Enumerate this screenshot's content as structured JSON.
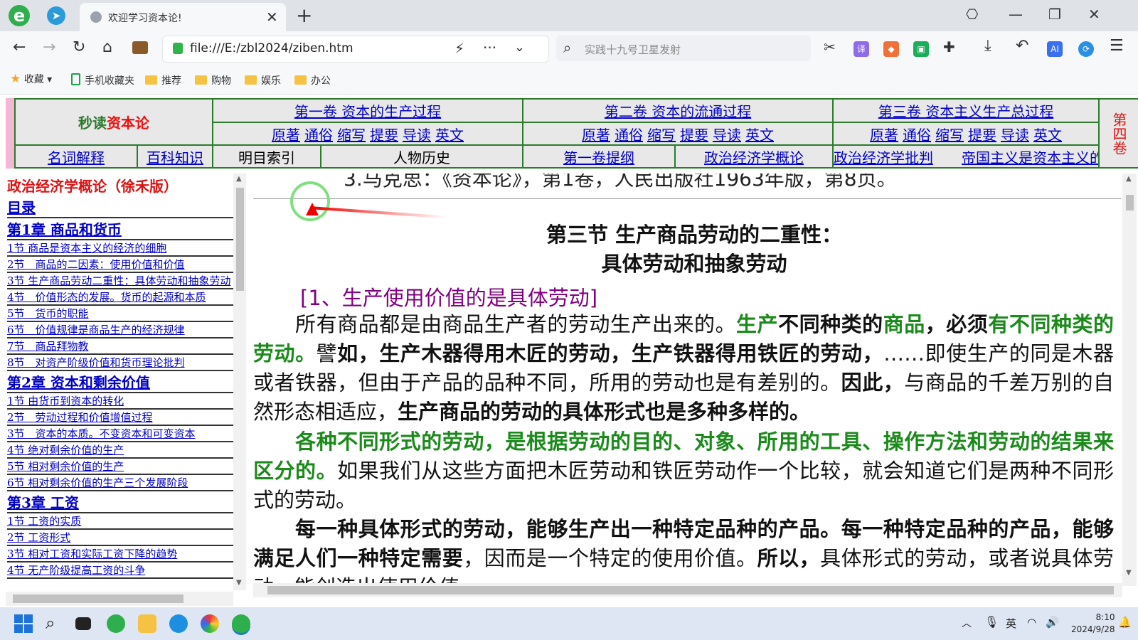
{
  "browser": {
    "tab_title": "欢迎学习资本论!",
    "url": "file:///E:/zbl2024/ziben.htm",
    "search_placeholder": "实践十九号卫星发射",
    "ext_translate": "译",
    "ext_ai": "AI"
  },
  "bookmarks": [
    {
      "label": "收藏"
    },
    {
      "label": "手机收藏夹"
    },
    {
      "label": "推荐"
    },
    {
      "label": "购物"
    },
    {
      "label": "娱乐"
    },
    {
      "label": "办公"
    }
  ],
  "topnav": {
    "brand_part1": "秒读",
    "brand_part2": "资本论",
    "vol1": "第一卷 资本的生产过程",
    "vol2": "第二卷 资本的流通过程",
    "vol3": "第三卷 资本主义生产总过程",
    "vol4": "第四卷",
    "sub_links": [
      "原著",
      "通俗",
      "缩写",
      "提要",
      "导读",
      "英文"
    ],
    "row3": [
      "名词解释",
      "百科知识",
      "明目索引",
      "人物历史",
      "第一卷提纲",
      "政治经济学概论",
      "政治经济学批判",
      "帝国主义是资本主义的最高阶段"
    ]
  },
  "toc": {
    "title": "政治经济学概论（徐禾版）",
    "items": [
      {
        "type": "ch",
        "label": "目录"
      },
      {
        "type": "ch",
        "label": "第1章 商品和货币"
      },
      {
        "type": "it",
        "label": "1节 商品是资本主义的经济的细胞"
      },
      {
        "type": "it",
        "label": "2节　商品的二因素：使用价值和价值"
      },
      {
        "type": "it",
        "label": "3节 生产商品劳动二重性：具体劳动和抽象劳动"
      },
      {
        "type": "it",
        "label": "4节　价值形态的发展。货币的起源和本质"
      },
      {
        "type": "it",
        "label": "5节　货币的职能"
      },
      {
        "type": "it",
        "label": "6节　价值规律是商品生产的经济规律"
      },
      {
        "type": "it",
        "label": "7节　商品拜物教"
      },
      {
        "type": "it",
        "label": "8节　对资产阶级价值和货币理论批判"
      },
      {
        "type": "ch",
        "label": "第2章 资本和剩余价值"
      },
      {
        "type": "it",
        "label": "1节 由货币到资本的转化"
      },
      {
        "type": "it",
        "label": "2节　劳动过程和价值增值过程"
      },
      {
        "type": "it",
        "label": "3节　资本的本质。不变资本和可变资本"
      },
      {
        "type": "it",
        "label": "4节 绝对剩余价值的生产"
      },
      {
        "type": "it",
        "label": "5节 相对剩余价值的生产"
      },
      {
        "type": "it",
        "label": "6节 相对剩余价值的生产三个发展阶段"
      },
      {
        "type": "ch",
        "label": "第3章 工资"
      },
      {
        "type": "it",
        "label": "1节 工资的实质"
      },
      {
        "type": "it",
        "label": "2节 工资形式"
      },
      {
        "type": "it",
        "label": "3节 相对工资和实际工资下降的趋势"
      },
      {
        "type": "it",
        "label": "4节 无产阶级提高工资的斗争"
      }
    ]
  },
  "content": {
    "ref": "3.马克思：《资本论》，第1卷，人民出版社1963年版，第8页。",
    "title1": "第三节  生产商品劳动的二重性：",
    "title2": "具体劳动和抽象劳动",
    "subheading": "[1、生产使用价值的是具体劳动]",
    "p1": [
      {
        "t": "　　所有商品都是由商品生产者的劳动生产出来的。",
        "s": ""
      },
      {
        "t": "生产",
        "s": "gr"
      },
      {
        "t": "不同种类的",
        "s": "b"
      },
      {
        "t": "商品",
        "s": "gr"
      },
      {
        "t": "，必须",
        "s": "b"
      },
      {
        "t": "有不同种类的劳动。",
        "s": "gr"
      },
      {
        "t": "譬",
        "s": ""
      },
      {
        "t": "如，生产木器得用木匠的劳动，生产铁器得用铁匠的劳动，",
        "s": "b"
      },
      {
        "t": "……即使生产的同是木器或者铁器，但由于产品的品种不同，所用的劳动也是有差别的。",
        "s": ""
      },
      {
        "t": "因此，",
        "s": "b"
      },
      {
        "t": "与商品的千差万别的自然形态相适应，",
        "s": ""
      },
      {
        "t": "生产商品的劳动的具体形式",
        "s": "b"
      },
      {
        "t": "也是多种多样的。",
        "s": "b"
      }
    ],
    "p2": [
      {
        "t": "　　",
        "s": ""
      },
      {
        "t": "各种不同形式的劳动，是根据劳动的目的、对象、所用的工具、操作方法和劳动的结果来区分的。",
        "s": "gr"
      },
      {
        "t": "如果我们从这些方面把木匠劳动和铁匠劳动作一个比较，就会知道它们是两种不同形式的劳动。",
        "s": ""
      }
    ],
    "p3": [
      {
        "t": "　　每一种具体形式的劳动，能够生产出一种特定品种的产品。每一种特定品种的产品，能够满足人们一种特定需要",
        "s": "b"
      },
      {
        "t": "，因而是一个特定的使用价值。",
        "s": ""
      },
      {
        "t": "所以，",
        "s": "b"
      },
      {
        "t": "具体形式的劳动，或者说具体劳动，能创造出使用价值。",
        "s": ""
      }
    ]
  },
  "taskbar": {
    "ime": "英",
    "time": "8:10",
    "date": "2024/9/28"
  }
}
